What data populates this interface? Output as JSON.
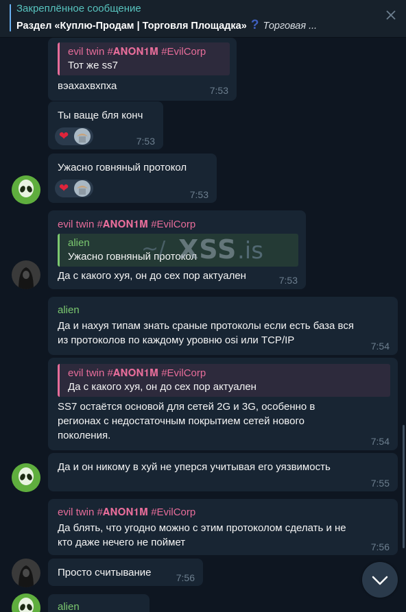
{
  "pinned": {
    "title": "Закреплённое сообщение",
    "text_main": "Раздел «Куплю-Продам | Торговля Площадка»",
    "text_icon": "?",
    "text_tail": "Торговая ..."
  },
  "icons": {
    "close": "close-icon",
    "scroll_down": "chevron-down-icon",
    "heart": "heart-icon"
  },
  "watermark": {
    "tilde": "~/",
    "main": "XSS",
    "ext": ".is"
  },
  "messages": [
    {
      "quote_name": "evil twin #𝐀𝐍𝐎𝐍𝟏𝐌 #EvilCorp",
      "quote_text": "Тот же ss7",
      "lines": [
        "вэахахвхпха"
      ],
      "time": "7:53"
    },
    {
      "lines": [
        "Ты ваще бля конч"
      ],
      "reaction": "❤",
      "time": "7:53"
    },
    {
      "lines": [
        "Ужасно говняный протокол"
      ],
      "reaction": "❤",
      "time": "7:53"
    },
    {
      "sender": "evil twin #𝐀𝐍𝐎𝐍𝟏𝐌 #EvilCorp",
      "quote_name": "alien",
      "quote_text": "Ужасно говняный протокол",
      "lines": [
        "Да с какого хуя, он до сех пор актуален"
      ],
      "time": "7:53"
    },
    {
      "sender": "alien",
      "lines": [
        "Да и нахуя типам знать сраные протоколы если есть база вся",
        "из протоколов по каждому уровню osi или TCP/IP"
      ],
      "time": "7:54"
    },
    {
      "quote_name": "evil twin #𝐀𝐍𝐎𝐍𝟏𝐌 #EvilCorp",
      "quote_text": "Да с какого хуя, он до сех пор актуален",
      "lines": [
        "SS7 остаётся основой для сетей 2G и 3G, особенно в",
        "регионах с недостаточным покрытием сетей нового",
        "поколения."
      ],
      "time": "7:54"
    },
    {
      "lines": [
        "Да и он никому в хуй не уперся учитывая его уязвимость"
      ],
      "time": "7:55"
    },
    {
      "sender": "evil twin #𝐀𝐍𝐎𝐍𝟏𝐌 #EvilCorp",
      "lines": [
        "Да блять, что угодно можно с этим протоколом сделать и не",
        "кто даже нечего не поймет"
      ],
      "time": "7:56"
    },
    {
      "lines": [
        "Просто считывание"
      ],
      "time": "7:56"
    },
    {
      "sender": "alien",
      "lines": [],
      "time": ""
    }
  ]
}
